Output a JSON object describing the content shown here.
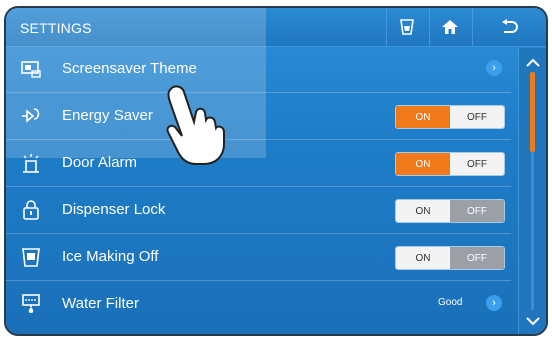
{
  "header": {
    "title": "SETTINGS"
  },
  "topbar": {
    "buttons": [
      {
        "name": "water-cup-icon"
      },
      {
        "name": "home-icon"
      },
      {
        "name": "back-icon"
      }
    ]
  },
  "rows": [
    {
      "label": "Screensaver Theme",
      "icon": "screensaver-icon",
      "control": "chevron"
    },
    {
      "label": "Energy Saver",
      "icon": "energy-saver-icon",
      "control": "toggle",
      "state": "ON"
    },
    {
      "label": "Door Alarm",
      "icon": "door-alarm-icon",
      "control": "toggle",
      "state": "ON"
    },
    {
      "label": "Dispenser Lock",
      "icon": "lock-icon",
      "control": "toggle",
      "state": "OFF"
    },
    {
      "label": "Ice Making Off",
      "icon": "ice-off-icon",
      "control": "toggle",
      "state": "OFF"
    },
    {
      "label": "Water Filter",
      "icon": "water-filter-icon",
      "control": "chevron",
      "status": "Good"
    }
  ],
  "toggle_labels": {
    "on": "ON",
    "off": "OFF"
  },
  "colors": {
    "accent": "#f07a1a",
    "panel": "#1f7dc8"
  }
}
